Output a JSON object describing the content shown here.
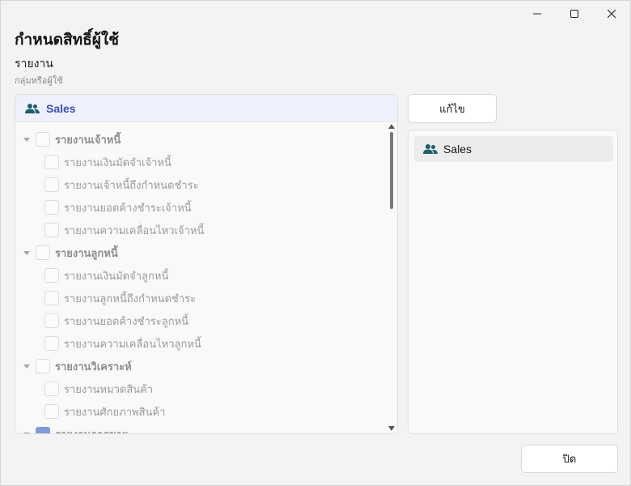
{
  "window": {
    "minimize_icon": "minimize-icon",
    "maximize_icon": "maximize-icon",
    "close_icon": "close-icon"
  },
  "title": "กำหนดสิทธิ์ผู้ใช้",
  "section": {
    "title": "รายงาน",
    "subtitle": "กลุ่มหรือผู้ใช้"
  },
  "left_panel": {
    "header_label": "Sales",
    "header_icon": "users-icon",
    "tree": [
      {
        "label": "รายงานเจ้าหนี้",
        "level": 0,
        "checked": false
      },
      {
        "label": "รายงานเงินมัดจำเจ้าหนี้",
        "level": 1,
        "checked": false
      },
      {
        "label": "รายงานเจ้าหนี้ถึงกำหนดชำระ",
        "level": 1,
        "checked": false
      },
      {
        "label": "รายงานยอดค้างชำระเจ้าหนี้",
        "level": 1,
        "checked": false
      },
      {
        "label": "รายงานความเคลื่อนไหวเจ้าหนี้",
        "level": 1,
        "checked": false
      },
      {
        "label": "รายงานลูกหนี้",
        "level": 0,
        "checked": false
      },
      {
        "label": "รายงานเงินมัดจำลูกหนี้",
        "level": 1,
        "checked": false
      },
      {
        "label": "รายงานลูกหนี้ถึงกำหนดชำระ",
        "level": 1,
        "checked": false
      },
      {
        "label": "รายงานยอดค้างชำระลูกหนี้",
        "level": 1,
        "checked": false
      },
      {
        "label": "รายงานความเคลื่อนไหวลูกหนี้",
        "level": 1,
        "checked": false
      },
      {
        "label": "รายงานวิเคราะห์",
        "level": 0,
        "checked": false
      },
      {
        "label": "รายงานหมวดสินค้า",
        "level": 1,
        "checked": false
      },
      {
        "label": "รายงานศักยภาพสินค้า",
        "level": 1,
        "checked": false
      },
      {
        "label": "รายงานการขาย",
        "level": 0,
        "checked": true
      }
    ]
  },
  "edit_button": "แก้ไข",
  "right_panel": {
    "items": [
      {
        "label": "Sales",
        "icon": "users-icon"
      }
    ]
  },
  "close_button": "ปิด",
  "colors": {
    "accent": "#3a4fb5",
    "icon_teal": "#1f5f6b",
    "header_bg": "#eef1fb",
    "checked": "#7f9bd8"
  }
}
